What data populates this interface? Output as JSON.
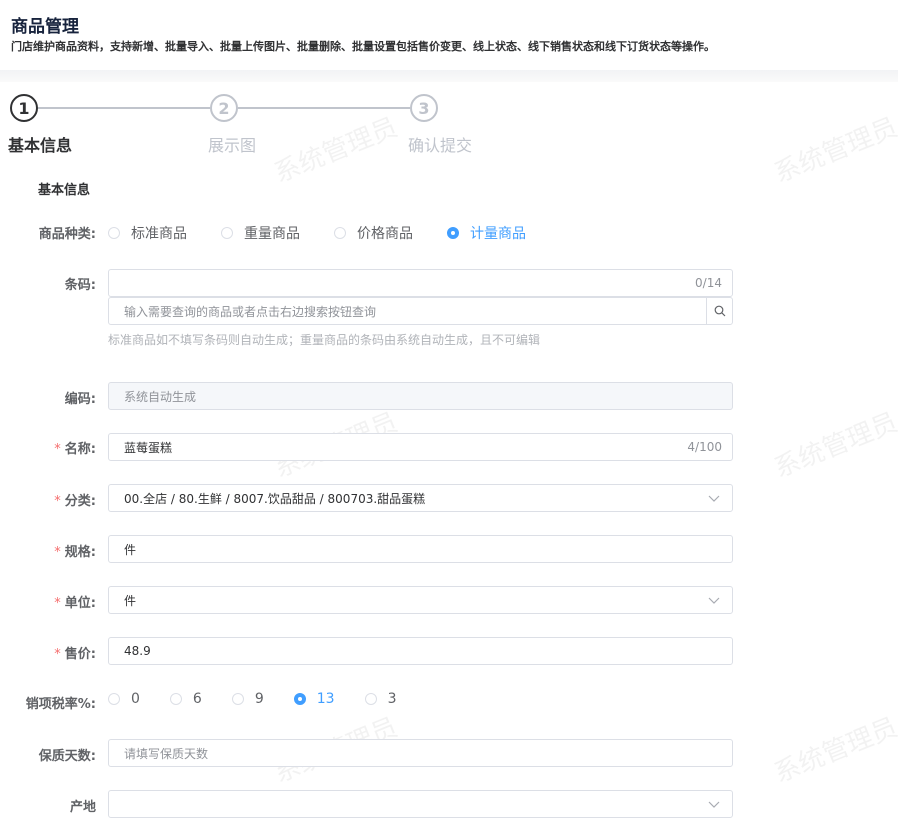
{
  "header": {
    "title": "商品管理",
    "description": "门店维护商品资料，支持新增、批量导入、批量上传图片、批量删除、批量设置包括售价变更、线上状态、线下销售状态和线下订货状态等操作。"
  },
  "steps": [
    {
      "number": "1",
      "title": "基本信息",
      "status": "active"
    },
    {
      "number": "2",
      "title": "展示图",
      "status": "wait"
    },
    {
      "number": "3",
      "title": "确认提交",
      "status": "wait"
    }
  ],
  "section_title": "基本信息",
  "watermark": "系统管理员",
  "form": {
    "type": {
      "label": "商品种类:",
      "options": [
        "标准商品",
        "重量商品",
        "价格商品",
        "计量商品"
      ],
      "selected": "计量商品"
    },
    "barcode": {
      "label": "条码:",
      "value": "",
      "counter": "0/14",
      "search_placeholder": "输入需要查询的商品或者点击右边搜索按钮查询",
      "hint": "标准商品如不填写条码则自动生成；重量商品的条码由系统自动生成，且不可编辑"
    },
    "code": {
      "label": "编码:",
      "placeholder": "系统自动生成"
    },
    "name": {
      "required": "*",
      "label": "名称:",
      "value": "蓝莓蛋糕",
      "counter": "4/100"
    },
    "category": {
      "required": "*",
      "label": "分类:",
      "value": "00.全店 / 80.生鲜 / 8007.饮品甜品 / 800703.甜品蛋糕"
    },
    "spec": {
      "required": "*",
      "label": "规格:",
      "value": "件"
    },
    "unit": {
      "required": "*",
      "label": "单位:",
      "value": "件"
    },
    "price": {
      "required": "*",
      "label": "售价:",
      "value": "48.9"
    },
    "tax": {
      "label": "销项税率%:",
      "options": [
        "0",
        "6",
        "9",
        "13",
        "3"
      ],
      "selected": "13"
    },
    "shelf_life": {
      "label": "保质天数:",
      "placeholder": "请填写保质天数"
    },
    "origin": {
      "label": "产地",
      "value": ""
    }
  },
  "colors": {
    "primary": "#409eff",
    "required": "#f56c6c",
    "border": "#dcdfe6"
  }
}
